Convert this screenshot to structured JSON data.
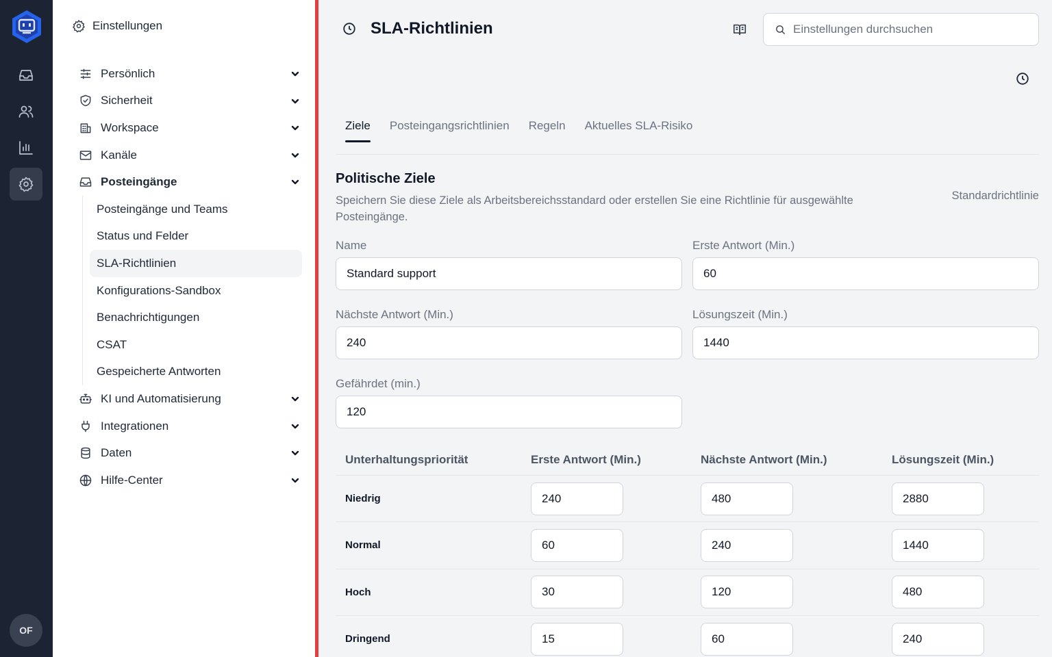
{
  "rail": {
    "items": [
      "inbox-icon",
      "contacts-icon",
      "reports-icon",
      "settings-icon"
    ],
    "active": "settings-icon",
    "avatar_initials": "OF"
  },
  "sidebar": {
    "header": "Einstellungen",
    "items": [
      {
        "label": "Persönlich",
        "icon": "sliders-icon"
      },
      {
        "label": "Sicherheit",
        "icon": "shield-icon"
      },
      {
        "label": "Workspace",
        "icon": "building-icon"
      },
      {
        "label": "Kanäle",
        "icon": "mail-icon"
      },
      {
        "label": "Posteingänge",
        "icon": "inbox-icon",
        "expanded": true
      },
      {
        "label": "KI und Automatisierung",
        "icon": "bot-icon"
      },
      {
        "label": "Integrationen",
        "icon": "plug-icon"
      },
      {
        "label": "Daten",
        "icon": "database-icon"
      },
      {
        "label": "Hilfe-Center",
        "icon": "globe-icon"
      }
    ],
    "sub_items": [
      {
        "label": "Posteingänge und Teams"
      },
      {
        "label": "Status und Felder"
      },
      {
        "label": "SLA-Richtlinien",
        "active": true
      },
      {
        "label": "Konfigurations-Sandbox"
      },
      {
        "label": "Benachrichtigungen"
      },
      {
        "label": "CSAT"
      },
      {
        "label": "Gespeicherte Antworten"
      }
    ]
  },
  "header": {
    "title": "SLA-Richtlinien",
    "search_placeholder": "Einstellungen durchsuchen"
  },
  "tabs": [
    {
      "label": "Ziele",
      "active": true
    },
    {
      "label": "Posteingangsrichtlinien"
    },
    {
      "label": "Regeln"
    },
    {
      "label": "Aktuelles SLA-Risiko"
    }
  ],
  "section": {
    "title": "Politische Ziele",
    "description": "Speichern Sie diese Ziele als Arbeitsbereichsstandard oder erstellen Sie eine Richtlinie für ausgewählte Posteingänge.",
    "badge": "Standardrichtlinie"
  },
  "form": {
    "name_label": "Name",
    "name_value": "Standard support",
    "first_response_label": "Erste Antwort (Min.)",
    "first_response_value": "60",
    "next_response_label": "Nächste Antwort (Min.)",
    "next_response_value": "240",
    "resolution_label": "Lösungszeit (Min.)",
    "resolution_value": "1440",
    "at_risk_label": "Gefährdet (min.)",
    "at_risk_value": "120"
  },
  "priority_table": {
    "headers": [
      "Unterhaltungspriorität",
      "Erste Antwort (Min.)",
      "Nächste Antwort (Min.)",
      "Lösungszeit (Min.)"
    ],
    "rows": [
      {
        "priority": "Niedrig",
        "first": "240",
        "next": "480",
        "resolution": "2880"
      },
      {
        "priority": "Normal",
        "first": "60",
        "next": "240",
        "resolution": "1440"
      },
      {
        "priority": "Hoch",
        "first": "30",
        "next": "120",
        "resolution": "480"
      },
      {
        "priority": "Dringend",
        "first": "15",
        "next": "60",
        "resolution": "240"
      }
    ]
  }
}
